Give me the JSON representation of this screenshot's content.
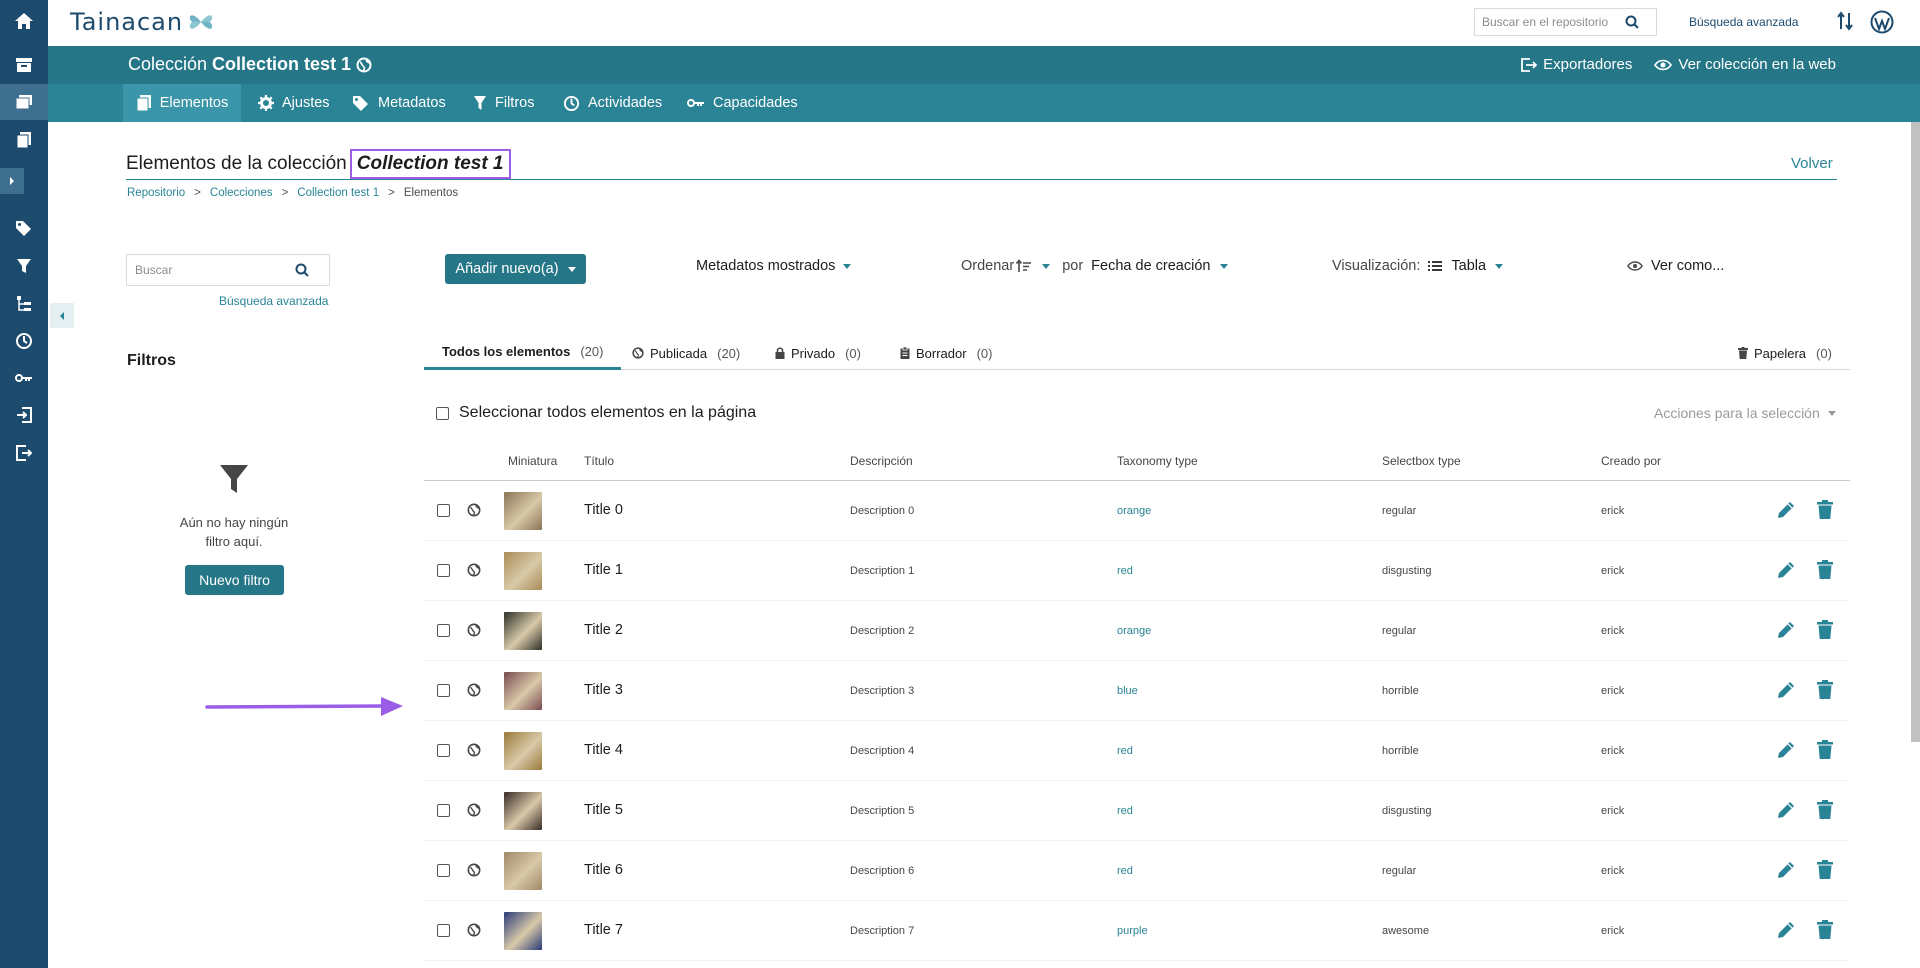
{
  "topbar": {
    "logo_text": "Tainacan",
    "repo_search_placeholder": "Buscar en el repositorio",
    "advanced_search": "Búsqueda avanzada"
  },
  "collection_header": {
    "prefix": "Colección",
    "name": "Collection test 1",
    "exporters": "Exportadores",
    "view_on_web": "Ver colección en la web"
  },
  "tabs": [
    {
      "label": "Elementos",
      "icon": "copy-icon"
    },
    {
      "label": "Ajustes",
      "icon": "gear-icon"
    },
    {
      "label": "Metadatos",
      "icon": "tags-icon"
    },
    {
      "label": "Filtros",
      "icon": "filter-icon"
    },
    {
      "label": "Actividades",
      "icon": "activity-icon"
    },
    {
      "label": "Capacidades",
      "icon": "key-icon"
    }
  ],
  "page": {
    "title_prefix": "Elementos de la colección",
    "title_collection": "Collection test 1",
    "back": "Volver",
    "breadcrumb": [
      "Repositorio",
      "Colecciones",
      "Collection test 1",
      "Elementos"
    ],
    "breadcrumb_sep": ">"
  },
  "filters": {
    "search_placeholder": "Buscar",
    "advanced_search": "Búsqueda avanzada",
    "heading": "Filtros",
    "empty_line1": "Aún no hay ningún",
    "empty_line2": "filtro aquí.",
    "new_filter": "Nuevo filtro"
  },
  "toolbar": {
    "add_new": "Añadir nuevo(a)",
    "metadata_shown": "Metadatos mostrados",
    "order": "Ordenar",
    "by": "por",
    "order_field": "Fecha de creación",
    "view_label": "Visualización:",
    "view_mode": "Tabla",
    "view_as": "Ver como..."
  },
  "status_tabs": [
    {
      "label": "Todos los elementos",
      "count": "(20)"
    },
    {
      "label": "Publicada",
      "count": "(20)"
    },
    {
      "label": "Privado",
      "count": "(0)"
    },
    {
      "label": "Borrador",
      "count": "(0)"
    },
    {
      "label": "Papelera",
      "count": "(0)"
    }
  ],
  "select_all": "Seleccionar todos elementos en la página",
  "bulk_actions": "Acciones para la selección",
  "table": {
    "headers": [
      "Miniatura",
      "Título",
      "Descripción",
      "Taxonomy type",
      "Selectbox type",
      "Creado por"
    ],
    "rows": [
      {
        "title": "Title 0",
        "description": "Description 0",
        "taxonomy": "orange",
        "selectbox": "regular",
        "created_by": "erick",
        "thumb_color": "#8a7456"
      },
      {
        "title": "Title 1",
        "description": "Description 1",
        "taxonomy": "red",
        "selectbox": "disgusting",
        "created_by": "erick",
        "thumb_color": "#a88b55"
      },
      {
        "title": "Title 2",
        "description": "Description 2",
        "taxonomy": "orange",
        "selectbox": "regular",
        "created_by": "erick",
        "thumb_color": "#2e3028"
      },
      {
        "title": "Title 3",
        "description": "Description 3",
        "taxonomy": "blue",
        "selectbox": "horrible",
        "created_by": "erick",
        "thumb_color": "#7a4a52"
      },
      {
        "title": "Title 4",
        "description": "Description 4",
        "taxonomy": "red",
        "selectbox": "horrible",
        "created_by": "erick",
        "thumb_color": "#9b7a3a"
      },
      {
        "title": "Title 5",
        "description": "Description 5",
        "taxonomy": "red",
        "selectbox": "disgusting",
        "created_by": "erick",
        "thumb_color": "#3a2a28"
      },
      {
        "title": "Title 6",
        "description": "Description 6",
        "taxonomy": "red",
        "selectbox": "regular",
        "created_by": "erick",
        "thumb_color": "#a08868"
      },
      {
        "title": "Title 7",
        "description": "Description 7",
        "taxonomy": "purple",
        "selectbox": "awesome",
        "created_by": "erick",
        "thumb_color": "#2a3a78"
      }
    ]
  },
  "colors": {
    "sidebar": "#1c4b6e",
    "collection_bar": "#257787",
    "tabs_bar": "#2b8495",
    "accent": "#298596",
    "annotation": "#9b5ce6"
  }
}
